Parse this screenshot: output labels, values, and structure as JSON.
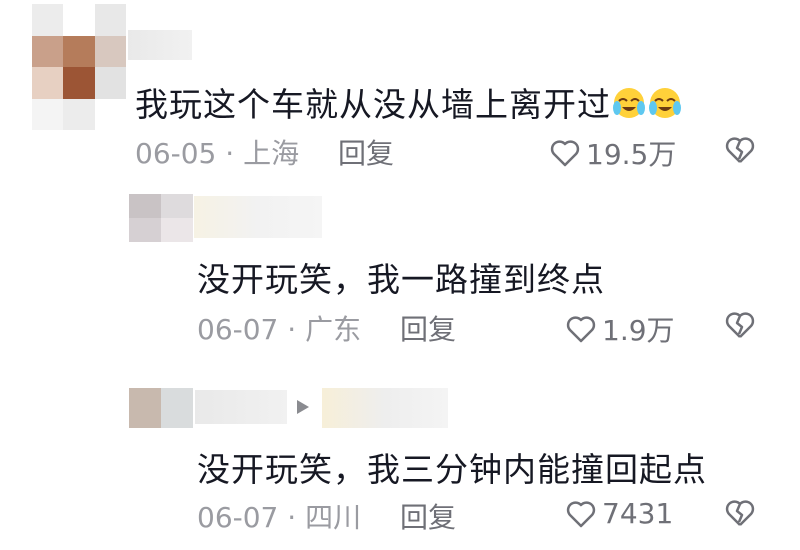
{
  "comments": [
    {
      "text": "我玩这个车就从没从墙上离开过",
      "emoji_name": "crying-laugh-emoji",
      "date": "06-05",
      "location": "上海",
      "reply_label": "回复",
      "likes": "19.5万"
    },
    {
      "text": "没开玩笑，我一路撞到终点",
      "date": "06-07",
      "location": "广东",
      "reply_label": "回复",
      "likes": "1.9万"
    },
    {
      "text": "没开玩笑，我三分钟内能撞回起点",
      "date": "06-07",
      "location": "四川",
      "reply_label": "回复",
      "likes": "7431"
    }
  ],
  "separator": "·",
  "icons": {
    "like": "heart-outline-icon",
    "dislike": "broken-heart-icon",
    "reply_arrow": "play-triangle-icon"
  },
  "colors": {
    "text": "#161823",
    "meta": "#9a9ba1",
    "action": "#6f7077"
  }
}
